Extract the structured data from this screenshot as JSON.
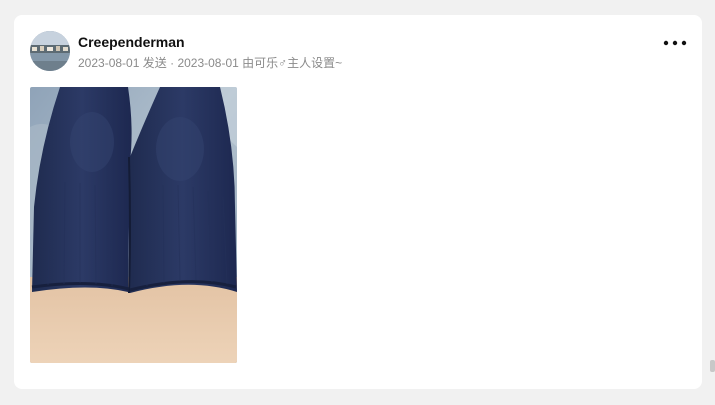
{
  "post": {
    "author": "Creependerman",
    "posted_date": "2023-08-01",
    "posted_label": "发送",
    "separator": "·",
    "set_date": "2023-08-01",
    "set_label": "由可乐♂主人设置~"
  },
  "menu": {
    "icon": "more-dots-icon"
  },
  "colors": {
    "page_bg": "#f1f1f1",
    "card_bg": "#ffffff",
    "author_text": "#111111",
    "meta_text": "#8a8a8a"
  }
}
